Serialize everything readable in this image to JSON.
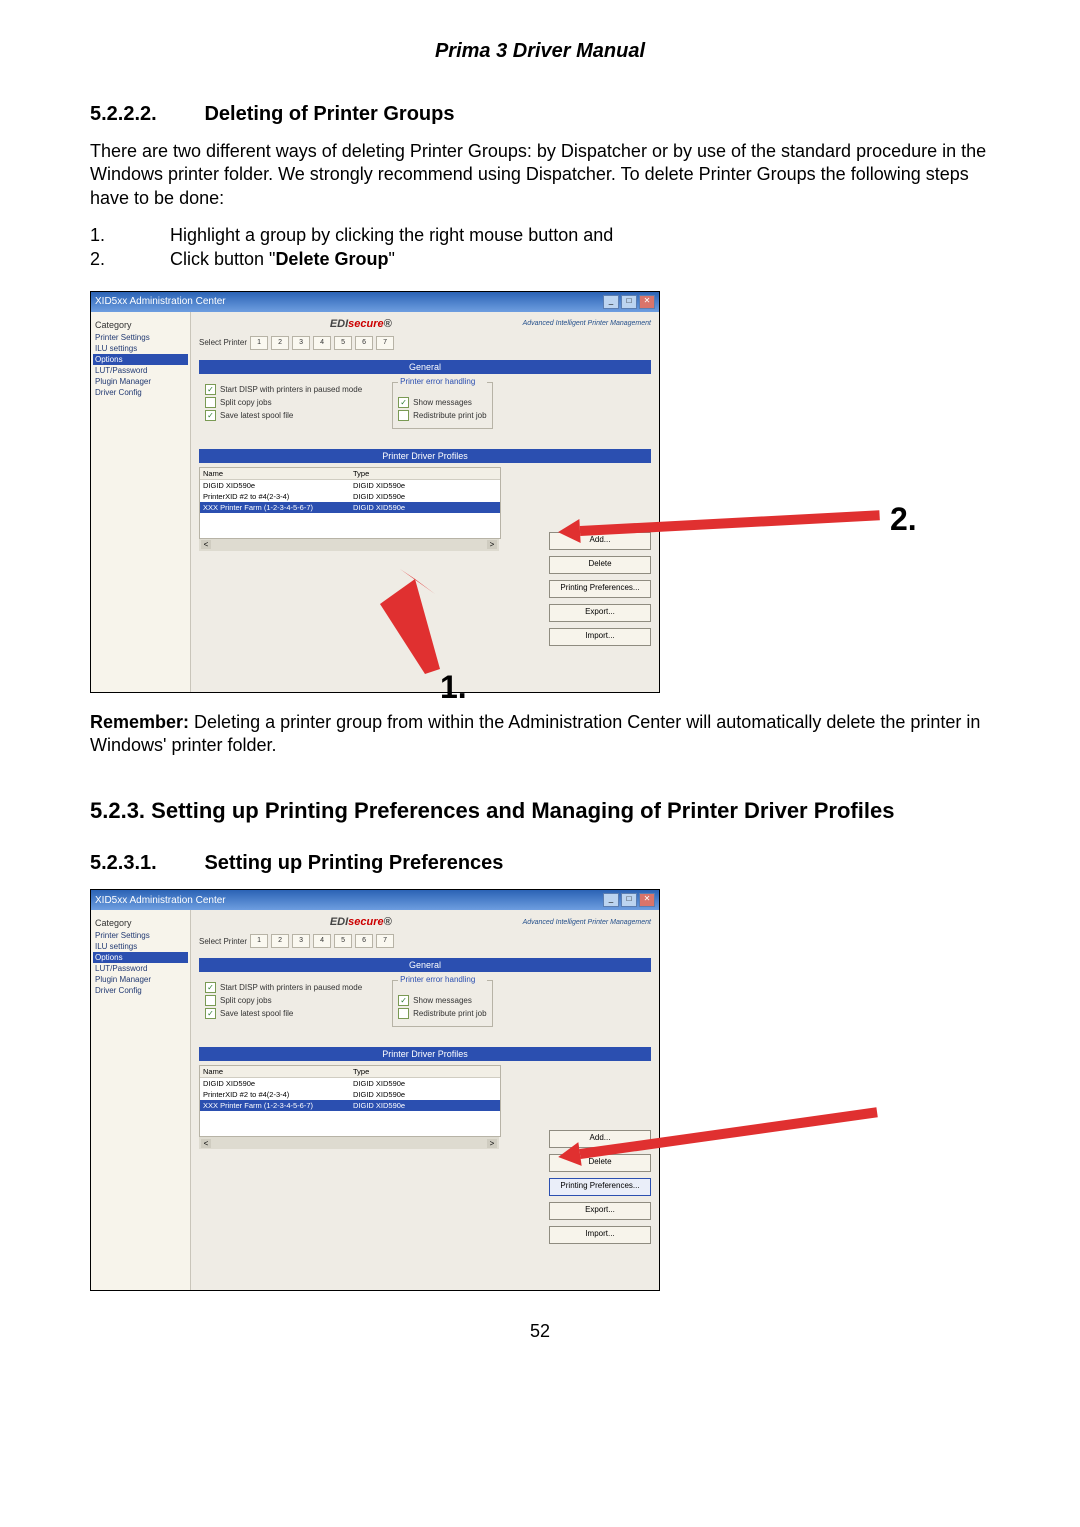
{
  "doc": {
    "header": "Prima 3 Driver Manual",
    "page_number": "52"
  },
  "sec1": {
    "num": "5.2.2.2.",
    "title": "Deleting of Printer Groups",
    "para": "There are two different ways of deleting Printer Groups: by Dispatcher or by use of the standard procedure in the Windows printer folder. We strongly recommend using Dispatcher. To delete Printer Groups the following steps have to be done:",
    "steps": [
      {
        "n": "1.",
        "t": "Highlight a group by clicking the right mouse button and"
      },
      {
        "n": "2.",
        "t_pre": "Click button \"",
        "t_bold": "Delete Group",
        "t_post": "\""
      }
    ],
    "remember_label": "Remember:",
    "remember_text": " Deleting a printer group from within the Administration Center will automatically delete the printer in Windows' printer folder."
  },
  "sec2": {
    "num_big": "5.2.3.",
    "title_big": "Setting up Printing Preferences and Managing of Printer Driver Profiles",
    "num": "5.2.3.1.",
    "title": "Setting up Printing Preferences"
  },
  "shot": {
    "window_title": "XID5xx Administration Center",
    "category_label": "Category",
    "sidebar": {
      "items": [
        "Printer Settings",
        "ILU settings",
        "Options",
        "LUT/Password",
        "Plugin Manager",
        "Driver Config"
      ],
      "selected_index": 2
    },
    "brand_prefix": "EDI",
    "brand_main": "secure",
    "brand_reg": "®",
    "brand_tag": "Advanced Intelligent\nPrinter Management",
    "select_printer_label": "Select Printer",
    "general_header": "General",
    "general_checks": {
      "start_paused": "Start DISP with printers in paused mode",
      "split_copy": "Split copy jobs",
      "save_spool": "Save latest spool file"
    },
    "error_group_label": "Printer error handling",
    "error_checks": {
      "show_msgs": "Show messages",
      "redistribute": "Redistribute print job"
    },
    "profiles_header": "Printer Driver Profiles",
    "table": {
      "col_name": "Name",
      "col_type": "Type",
      "rows": [
        {
          "name": "DIGID XID590e",
          "type": "DIGID XID590e"
        },
        {
          "name": "PrinterXID #2 to #4(2-3-4)",
          "type": "DIGID XID590e"
        },
        {
          "name": "XXX Printer Farm (1-2-3-4-5-6-7)",
          "type": "DIGID XID590e"
        }
      ],
      "selected_index": 2
    },
    "buttons": {
      "add": "Add...",
      "delete": "Delete",
      "pref": "Printing Preferences...",
      "export": "Export...",
      "import": "Import..."
    }
  },
  "callouts": {
    "one": "1.",
    "two": "2."
  }
}
